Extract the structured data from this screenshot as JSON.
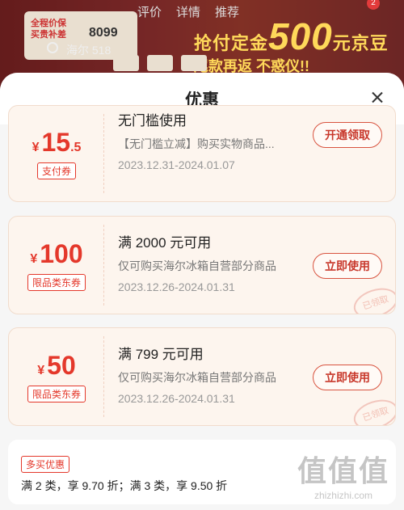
{
  "background": {
    "tabs": [
      "评价",
      "详情",
      "推荐"
    ],
    "badge": "2",
    "promo": {
      "line1": "抢付定金",
      "amount": "500",
      "unit": "元京豆",
      "line2": "尾款再返",
      "tail": "不惑仪!!"
    },
    "tile": {
      "text1": "全程价保",
      "text2": "买贵补差",
      "price": "8099"
    },
    "search_text": "海尔 518"
  },
  "sheet": {
    "title": "优惠",
    "close_icon": "close-icon"
  },
  "coupons": [
    {
      "currency": "¥",
      "amount": "15",
      "decimal": ".5",
      "tag": "支付券",
      "title": "无门槛使用",
      "desc": "【无门槛立减】购买实物商品...",
      "period": "2023.12.31-2024.01.07",
      "button": "开通领取",
      "stamp": ""
    },
    {
      "currency": "¥",
      "amount": "100",
      "decimal": "",
      "tag": "限品类东券",
      "title": "满 2000 元可用",
      "desc": "仅可购买海尔冰箱自营部分商品",
      "period": "2023.12.26-2024.01.31",
      "button": "立即使用",
      "stamp": "已领取"
    },
    {
      "currency": "¥",
      "amount": "50",
      "decimal": "",
      "tag": "限品类东券",
      "title": "满 799 元可用",
      "desc": "仅可购买海尔冰箱自营部分商品",
      "period": "2023.12.26-2024.01.31",
      "button": "立即使用",
      "stamp": "已领取"
    }
  ],
  "multi_buy": {
    "tag": "多买优惠",
    "text": "满 2 类，享 9.70 折；满 3 类，享 9.50 折"
  },
  "watermark": {
    "big": "值值值",
    "url": "zhizhizhi.com"
  },
  "colors": {
    "accent": "#e4382b",
    "coupon_bg": "#fdf5ee",
    "sheet_bg": "#f6f6f6"
  }
}
